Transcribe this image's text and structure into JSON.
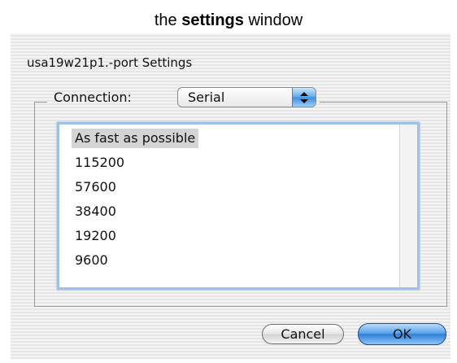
{
  "caption": {
    "prefix": "the",
    "bold": "settings",
    "suffix": "window"
  },
  "window": {
    "title": "usa19w21p1.-port Settings"
  },
  "connection": {
    "label": "Connection:",
    "selected": "Serial"
  },
  "speed_list": {
    "items": [
      {
        "label": "As fast as possible",
        "selected": true
      },
      {
        "label": "115200",
        "selected": false
      },
      {
        "label": "57600",
        "selected": false
      },
      {
        "label": "38400",
        "selected": false
      },
      {
        "label": "19200",
        "selected": false
      },
      {
        "label": "9600",
        "selected": false
      }
    ]
  },
  "buttons": {
    "cancel": "Cancel",
    "ok": "OK"
  },
  "colors": {
    "selection": "#d4d4d4",
    "focus_ring": "#9cc2e8",
    "default_button": "#3b8de0"
  },
  "icons": {
    "popup_arrows": "up-down-arrows-icon"
  }
}
